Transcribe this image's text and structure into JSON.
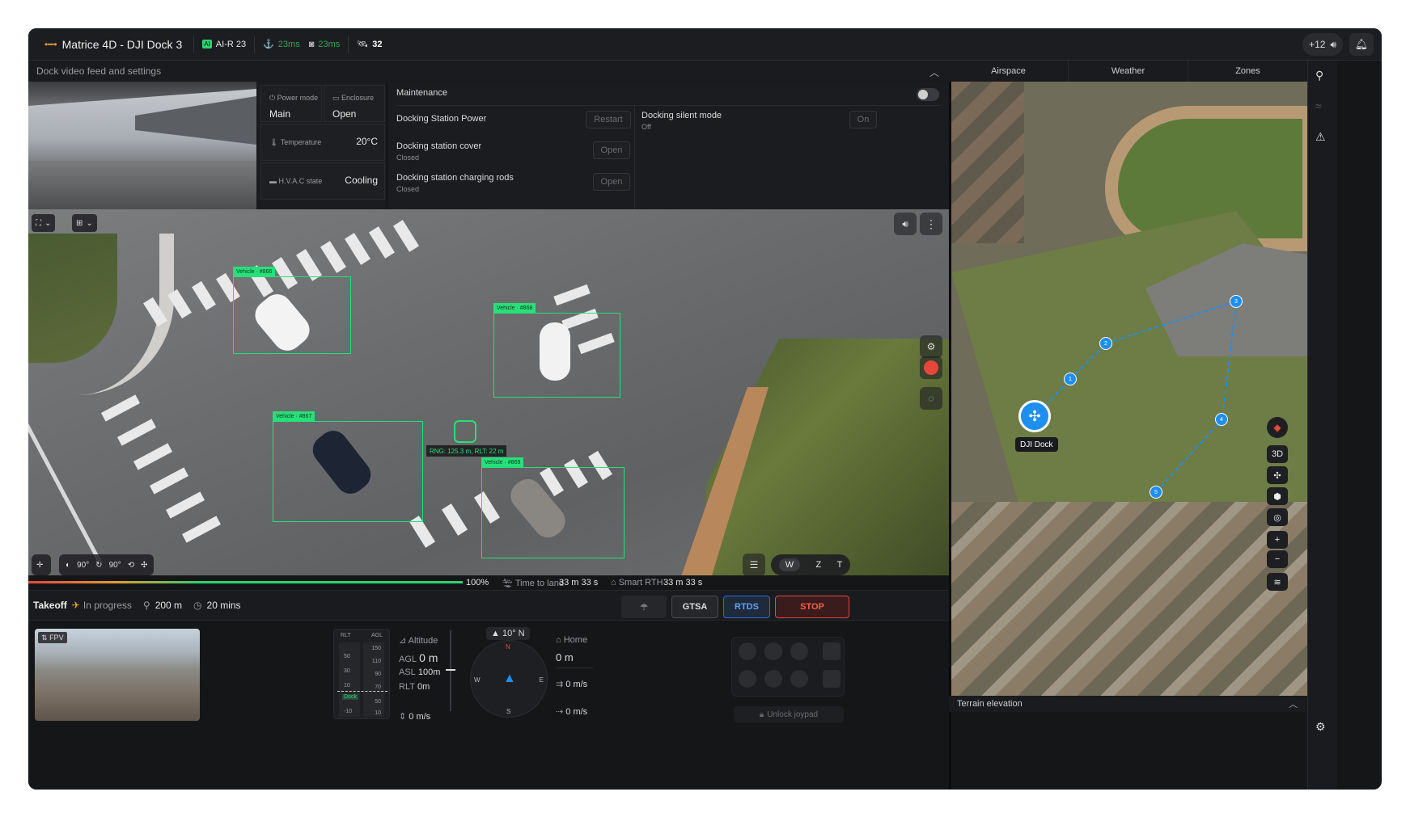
{
  "topbar": {
    "title": "Matrice 4D - DJI Dock 3",
    "ai_label": "AI-R 23",
    "latency1": "23ms",
    "latency2": "23ms",
    "satellites": "32",
    "notif_count": "+12"
  },
  "dock": {
    "header": "Dock video feed and settings",
    "power_mode_label": "Power mode",
    "power_mode_value": "Main",
    "enclosure_label": "Enclosure",
    "enclosure_value": "Open",
    "temperature_label": "Temperature",
    "temperature_value": "20°C",
    "hvac_label": "H.V.A.C state",
    "hvac_value": "Cooling",
    "maintenance_label": "Maintenance",
    "power_label": "Docking Station Power",
    "power_btn": "Restart",
    "silent_label": "Docking silent mode",
    "silent_sub": "Off",
    "silent_btn": "On",
    "cover_label": "Docking station cover",
    "cover_sub": "Closed",
    "cover_btn": "Open",
    "rods_label": "Docking station charging rods",
    "rods_sub": "Closed",
    "rods_btn": "Open"
  },
  "feed": {
    "detections": [
      {
        "label": "Vehicle · #866"
      },
      {
        "label": "Vehicle · #868"
      },
      {
        "label": "Vehicle · #867"
      },
      {
        "label": "Vehicle · #869"
      }
    ],
    "range_text": "RNG: 125.3 m, RLT: 22 m",
    "gimbal_pitch": "90°",
    "gimbal_yaw": "90°",
    "zoom_w": "W",
    "zoom_z": "Z",
    "zoom_t": "T",
    "record_color": "#e5483a"
  },
  "progress": {
    "percent_label": "100%",
    "percent_value": 100,
    "time_to_land_label": "Time to land",
    "time_to_land": "33 m 33 s",
    "smart_rth_label": "Smart RTH",
    "smart_rth": "33 m 33 s"
  },
  "mission": {
    "stage": "Takeoff",
    "status": "In progress",
    "distance": "200 m",
    "duration": "20 mins",
    "btn_gtsa": "GTSA",
    "btn_rtds": "RTDS",
    "btn_stop": "STOP"
  },
  "telemetry": {
    "fpv_tag": "FPV",
    "gauge_rlt": "RLT",
    "gauge_agl": "AGL",
    "gauge_ticks_left": [
      "50",
      "30",
      "10",
      "-10"
    ],
    "gauge_ticks_right": [
      "150",
      "110",
      "90",
      "70",
      "50",
      "10"
    ],
    "gauge_marker": "Dock",
    "altitude_label": "Altitude",
    "agl_label": "AGL",
    "agl_value": "0 m",
    "asl_label": "ASL",
    "asl_value": "100m",
    "rlt_label": "RLT",
    "rlt_value": "0m",
    "vspeed": "0 m/s",
    "heading": "10° N",
    "home_label": "Home",
    "home_value": "0 m",
    "hspeed1": "0 m/s",
    "hspeed2": "0 m/s",
    "unlock_joypad": "Unlock joypad"
  },
  "map": {
    "tabs": [
      "Airspace",
      "Weather",
      "Zones"
    ],
    "dock_label": "DJI Dock",
    "waypoints": [
      "1",
      "2",
      "3",
      "4",
      "5"
    ],
    "btn_3d": "3D",
    "terrain_label": "Terrain elevation",
    "accent": "#1e8ff0"
  }
}
